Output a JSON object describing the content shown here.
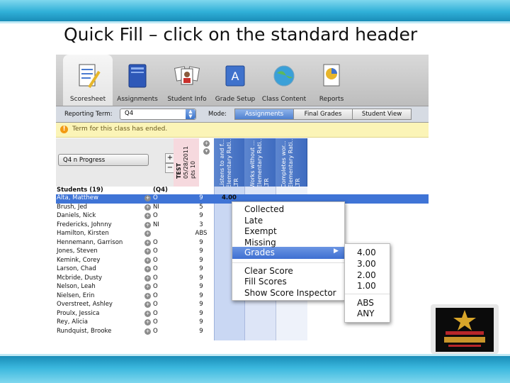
{
  "slide": {
    "title": "Quick Fill – click on the standard header"
  },
  "toolbar": {
    "items": [
      {
        "label": "Scoresheet",
        "icon": "scoresheet-icon"
      },
      {
        "label": "Assignments",
        "icon": "assignments-icon"
      },
      {
        "label": "Student Info",
        "icon": "student-info-icon"
      },
      {
        "label": "Grade Setup",
        "icon": "grade-setup-icon"
      },
      {
        "label": "Class Content",
        "icon": "class-content-icon"
      },
      {
        "label": "Reports",
        "icon": "reports-icon"
      }
    ]
  },
  "modebar": {
    "reporting_term_label": "Reporting Term:",
    "reporting_term_value": "Q4",
    "mode_label": "Mode:",
    "modes": [
      "Assignments",
      "Final Grades",
      "Student View"
    ],
    "active_mode": "Assignments"
  },
  "alert": {
    "text": "Term for this class has ended."
  },
  "left_panel": {
    "progress_label": "Q4  n Progress"
  },
  "columns": {
    "test": {
      "title": "TEST",
      "date": "05/28/2011",
      "points": "pts  10"
    },
    "assignments": [
      {
        "line1": "Listens to and f...",
        "line2": "Elementary Rati...",
        "line3": "LTR"
      },
      {
        "line1": "Works without ...",
        "line2": "Elementary Rati...",
        "line3": "LTR"
      },
      {
        "line1": "Completes wor...",
        "line2": "Elementary Rati...",
        "line3": "LTR"
      }
    ]
  },
  "students": {
    "header": "Students (19)",
    "term_header": "(Q4)",
    "rows": [
      {
        "name": "Alta, Matthew",
        "grade": "O",
        "score": "9",
        "std": "4.00",
        "selected": true
      },
      {
        "name": "Brush, Jed",
        "grade": "NI",
        "score": "5",
        "std": ""
      },
      {
        "name": "Daniels, Nick",
        "grade": "O",
        "score": "9",
        "std": ""
      },
      {
        "name": "Fredericks, Johnny",
        "grade": "NI",
        "score": "3",
        "std": ""
      },
      {
        "name": "Hamilton, Kirsten",
        "grade": "",
        "score": "ABS",
        "std": ""
      },
      {
        "name": "Hennemann, Garrison",
        "grade": "O",
        "score": "9",
        "std": ""
      },
      {
        "name": "Jones, Steven",
        "grade": "O",
        "score": "9",
        "std": ""
      },
      {
        "name": "Kemink, Corey",
        "grade": "O",
        "score": "9",
        "std": ""
      },
      {
        "name": "Larson, Chad",
        "grade": "O",
        "score": "9",
        "std": ""
      },
      {
        "name": "Mcbride, Dusty",
        "grade": "O",
        "score": "9",
        "std": ""
      },
      {
        "name": "Nelson, Leah",
        "grade": "O",
        "score": "9",
        "std": ""
      },
      {
        "name": "Nielsen, Erin",
        "grade": "O",
        "score": "9",
        "std": ""
      },
      {
        "name": "Overstreet, Ashley",
        "grade": "O",
        "score": "9",
        "std": ""
      },
      {
        "name": "Proulx, Jessica",
        "grade": "O",
        "score": "9",
        "std": ""
      },
      {
        "name": "Rey, Alicia",
        "grade": "O",
        "score": "9",
        "std": ""
      },
      {
        "name": "Rundquist, Brooke",
        "grade": "O",
        "score": "9",
        "std": ""
      }
    ]
  },
  "context_menu": {
    "items": [
      "Collected",
      "Late",
      "Exempt",
      "Missing",
      "Grades",
      "Clear Score",
      "Fill Scores",
      "Show Score Inspector"
    ],
    "highlighted": "Grades"
  },
  "submenu": {
    "items": [
      "4.00",
      "3.00",
      "2.00",
      "1.00",
      "ABS",
      "ANY"
    ]
  },
  "colors": {
    "accent": "#3e6fd1",
    "header_bar": "#30b0d8",
    "alert_bg": "#fbf4b7"
  }
}
